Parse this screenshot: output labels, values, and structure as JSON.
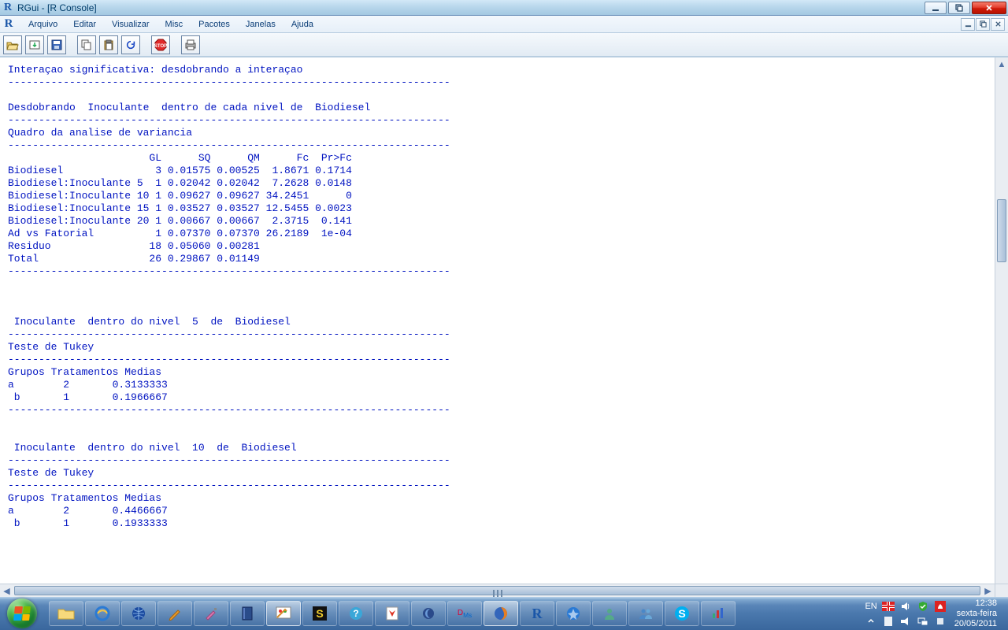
{
  "window": {
    "title": "RGui - [R Console]"
  },
  "menu": {
    "items": [
      "Arquivo",
      "Editar",
      "Visualizar",
      "Misc",
      "Pacotes",
      "Janelas",
      "Ajuda"
    ]
  },
  "toolbar_icons": [
    "open",
    "load",
    "save",
    "copy",
    "paste",
    "refresh",
    "stop",
    "print"
  ],
  "console_text": "Interaçao significativa: desdobrando a interaçao\n------------------------------------------------------------------------\n\nDesdobrando  Inoculante  dentro de cada nivel de  Biodiesel \n------------------------------------------------------------------------\nQuadro da analise de variancia\n------------------------------------------------------------------------\n                       GL      SQ      QM      Fc  Pr>Fc\nBiodiesel               3 0.01575 0.00525  1.8671 0.1714\nBiodiesel:Inoculante 5  1 0.02042 0.02042  7.2628 0.0148\nBiodiesel:Inoculante 10 1 0.09627 0.09627 34.2451      0\nBiodiesel:Inoculante 15 1 0.03527 0.03527 12.5455 0.0023\nBiodiesel:Inoculante 20 1 0.00667 0.00667  2.3715  0.141\nAd vs Fatorial          1 0.07370 0.07370 26.2189  1e-04\nResiduo                18 0.05060 0.00281               \nTotal                  26 0.29867 0.01149               \n------------------------------------------------------------------------\n\n\n\n Inoculante  dentro do nivel  5  de  Biodiesel \n------------------------------------------------------------------------\nTeste de Tukey\n------------------------------------------------------------------------\nGrupos Tratamentos Medias\na \t 2 \t 0.3133333 \n b \t 1 \t 0.1966667 \n------------------------------------------------------------------------\n\n\n Inoculante  dentro do nivel  10  de  Biodiesel \n------------------------------------------------------------------------\nTeste de Tukey\n------------------------------------------------------------------------\nGrupos Tratamentos Medias\na \t 2 \t 0.4466667 \n b \t 1 \t 0.1933333 ",
  "taskbar": {
    "apps": [
      "explorer",
      "ie",
      "globe",
      "folder-orange",
      "brush",
      "book",
      "paint-app",
      "s-yellow",
      "help",
      "pdf",
      "moon",
      "dms",
      "firefox",
      "r",
      "media",
      "person",
      "people",
      "skype",
      "chart"
    ],
    "lang": "EN",
    "time": "12:38",
    "day": "sexta-feira",
    "date": "20/05/2011"
  }
}
